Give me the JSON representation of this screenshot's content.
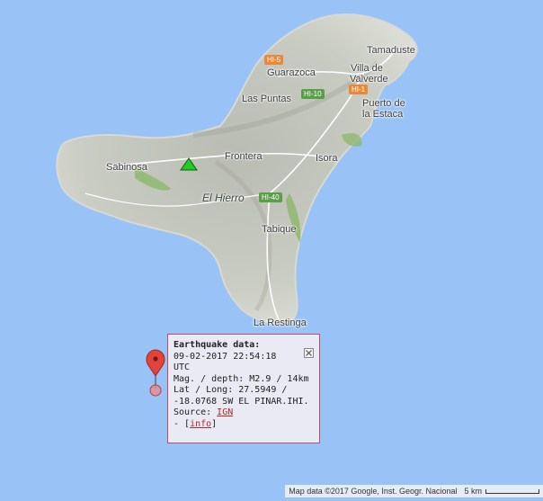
{
  "map": {
    "places": [
      "Tamaduste",
      "Guarazoca",
      "Villa de Valverde",
      "Las Puntas",
      "Puerto de la Estaca",
      "Sabinosa",
      "Frontera",
      "Isora",
      "Tabique",
      "La Restinga"
    ],
    "villa_line1": "Villa de",
    "villa_line2": "Valverde",
    "puerto_line1": "Puerto de",
    "puerto_line2": "la Estaca",
    "island_name": "El Hierro",
    "roads": {
      "hi5": "HI-5",
      "hi10": "HI-10",
      "hi1": "HI-1",
      "hi40": "HI-40"
    },
    "colors": {
      "sea": "#99c3f6",
      "land": "#cdd0c6",
      "marker": "#e0443a",
      "triangle": "#22cc22"
    }
  },
  "popup": {
    "title": "Earthquake data:",
    "datetime_line1": "09-02-2017 22:54:18",
    "datetime_line2": "UTC",
    "magnitude_line": "Mag. / depth: M2.9 / 14km",
    "latlong_line1": "Lat / Long: 27.5949 /",
    "latlong_line2": "-18.0768 SW EL PINAR.IHI.",
    "source_prefix": "Source: ",
    "source_link": "IGN",
    "info_prefix": "- [",
    "info_link": "info",
    "info_suffix": "]"
  },
  "attribution": {
    "map_data": "Map data ©2017 Google, Inst. Geogr. Nacional",
    "scale_label": "5 km"
  }
}
